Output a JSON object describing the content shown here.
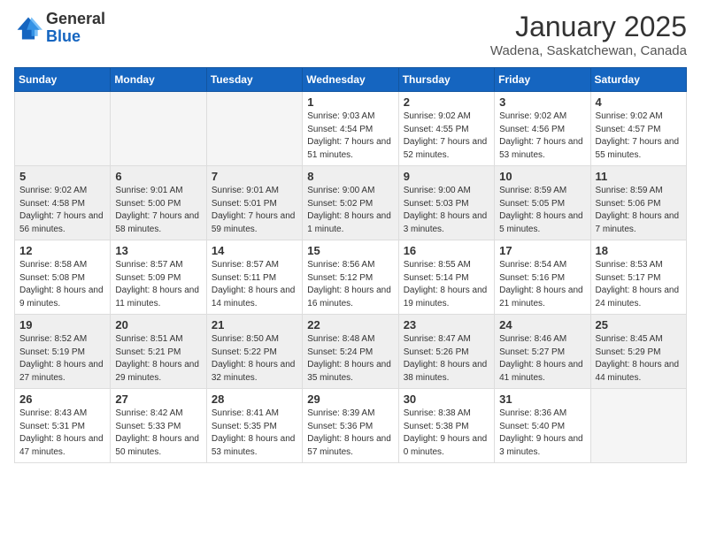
{
  "header": {
    "logo_general": "General",
    "logo_blue": "Blue",
    "month": "January 2025",
    "location": "Wadena, Saskatchewan, Canada"
  },
  "weekdays": [
    "Sunday",
    "Monday",
    "Tuesday",
    "Wednesday",
    "Thursday",
    "Friday",
    "Saturday"
  ],
  "weeks": [
    {
      "shaded": false,
      "days": [
        {
          "date": "",
          "info": ""
        },
        {
          "date": "",
          "info": ""
        },
        {
          "date": "",
          "info": ""
        },
        {
          "date": "1",
          "info": "Sunrise: 9:03 AM\nSunset: 4:54 PM\nDaylight: 7 hours\nand 51 minutes."
        },
        {
          "date": "2",
          "info": "Sunrise: 9:02 AM\nSunset: 4:55 PM\nDaylight: 7 hours\nand 52 minutes."
        },
        {
          "date": "3",
          "info": "Sunrise: 9:02 AM\nSunset: 4:56 PM\nDaylight: 7 hours\nand 53 minutes."
        },
        {
          "date": "4",
          "info": "Sunrise: 9:02 AM\nSunset: 4:57 PM\nDaylight: 7 hours\nand 55 minutes."
        }
      ]
    },
    {
      "shaded": true,
      "days": [
        {
          "date": "5",
          "info": "Sunrise: 9:02 AM\nSunset: 4:58 PM\nDaylight: 7 hours\nand 56 minutes."
        },
        {
          "date": "6",
          "info": "Sunrise: 9:01 AM\nSunset: 5:00 PM\nDaylight: 7 hours\nand 58 minutes."
        },
        {
          "date": "7",
          "info": "Sunrise: 9:01 AM\nSunset: 5:01 PM\nDaylight: 7 hours\nand 59 minutes."
        },
        {
          "date": "8",
          "info": "Sunrise: 9:00 AM\nSunset: 5:02 PM\nDaylight: 8 hours\nand 1 minute."
        },
        {
          "date": "9",
          "info": "Sunrise: 9:00 AM\nSunset: 5:03 PM\nDaylight: 8 hours\nand 3 minutes."
        },
        {
          "date": "10",
          "info": "Sunrise: 8:59 AM\nSunset: 5:05 PM\nDaylight: 8 hours\nand 5 minutes."
        },
        {
          "date": "11",
          "info": "Sunrise: 8:59 AM\nSunset: 5:06 PM\nDaylight: 8 hours\nand 7 minutes."
        }
      ]
    },
    {
      "shaded": false,
      "days": [
        {
          "date": "12",
          "info": "Sunrise: 8:58 AM\nSunset: 5:08 PM\nDaylight: 8 hours\nand 9 minutes."
        },
        {
          "date": "13",
          "info": "Sunrise: 8:57 AM\nSunset: 5:09 PM\nDaylight: 8 hours\nand 11 minutes."
        },
        {
          "date": "14",
          "info": "Sunrise: 8:57 AM\nSunset: 5:11 PM\nDaylight: 8 hours\nand 14 minutes."
        },
        {
          "date": "15",
          "info": "Sunrise: 8:56 AM\nSunset: 5:12 PM\nDaylight: 8 hours\nand 16 minutes."
        },
        {
          "date": "16",
          "info": "Sunrise: 8:55 AM\nSunset: 5:14 PM\nDaylight: 8 hours\nand 19 minutes."
        },
        {
          "date": "17",
          "info": "Sunrise: 8:54 AM\nSunset: 5:16 PM\nDaylight: 8 hours\nand 21 minutes."
        },
        {
          "date": "18",
          "info": "Sunrise: 8:53 AM\nSunset: 5:17 PM\nDaylight: 8 hours\nand 24 minutes."
        }
      ]
    },
    {
      "shaded": true,
      "days": [
        {
          "date": "19",
          "info": "Sunrise: 8:52 AM\nSunset: 5:19 PM\nDaylight: 8 hours\nand 27 minutes."
        },
        {
          "date": "20",
          "info": "Sunrise: 8:51 AM\nSunset: 5:21 PM\nDaylight: 8 hours\nand 29 minutes."
        },
        {
          "date": "21",
          "info": "Sunrise: 8:50 AM\nSunset: 5:22 PM\nDaylight: 8 hours\nand 32 minutes."
        },
        {
          "date": "22",
          "info": "Sunrise: 8:48 AM\nSunset: 5:24 PM\nDaylight: 8 hours\nand 35 minutes."
        },
        {
          "date": "23",
          "info": "Sunrise: 8:47 AM\nSunset: 5:26 PM\nDaylight: 8 hours\nand 38 minutes."
        },
        {
          "date": "24",
          "info": "Sunrise: 8:46 AM\nSunset: 5:27 PM\nDaylight: 8 hours\nand 41 minutes."
        },
        {
          "date": "25",
          "info": "Sunrise: 8:45 AM\nSunset: 5:29 PM\nDaylight: 8 hours\nand 44 minutes."
        }
      ]
    },
    {
      "shaded": false,
      "days": [
        {
          "date": "26",
          "info": "Sunrise: 8:43 AM\nSunset: 5:31 PM\nDaylight: 8 hours\nand 47 minutes."
        },
        {
          "date": "27",
          "info": "Sunrise: 8:42 AM\nSunset: 5:33 PM\nDaylight: 8 hours\nand 50 minutes."
        },
        {
          "date": "28",
          "info": "Sunrise: 8:41 AM\nSunset: 5:35 PM\nDaylight: 8 hours\nand 53 minutes."
        },
        {
          "date": "29",
          "info": "Sunrise: 8:39 AM\nSunset: 5:36 PM\nDaylight: 8 hours\nand 57 minutes."
        },
        {
          "date": "30",
          "info": "Sunrise: 8:38 AM\nSunset: 5:38 PM\nDaylight: 9 hours\nand 0 minutes."
        },
        {
          "date": "31",
          "info": "Sunrise: 8:36 AM\nSunset: 5:40 PM\nDaylight: 9 hours\nand 3 minutes."
        },
        {
          "date": "",
          "info": ""
        }
      ]
    }
  ]
}
